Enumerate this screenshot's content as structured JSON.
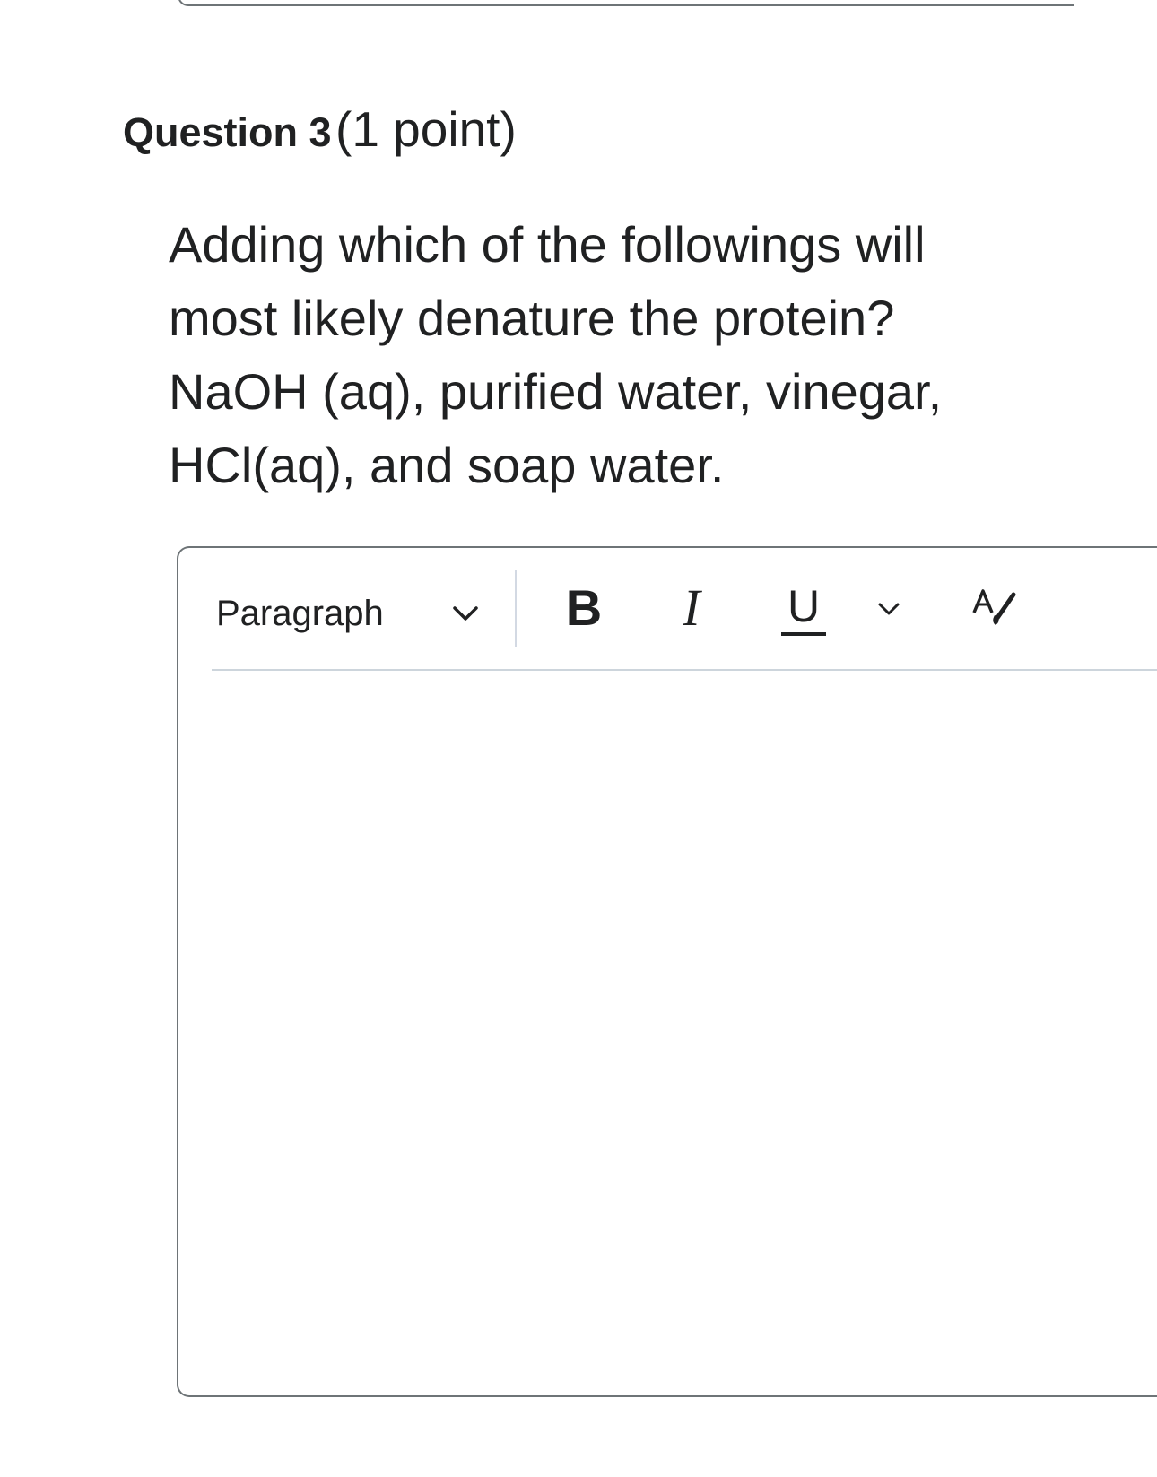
{
  "question": {
    "label": "Question 3",
    "points": "(1 point)",
    "lines": [
      "Adding which of the followings will",
      "most likely denature the protein?",
      "NaOH (aq), purified water, vinegar,",
      "HCl(aq), and soap water."
    ]
  },
  "editor": {
    "format_value": "Paragraph",
    "content": "",
    "icons": {
      "format_dropdown": "chevron-down-icon",
      "bold": "bold-icon",
      "italic": "italic-icon",
      "underline": "underline-icon",
      "underline_more": "chevron-down-icon",
      "text_style": "text-style-icon"
    }
  }
}
